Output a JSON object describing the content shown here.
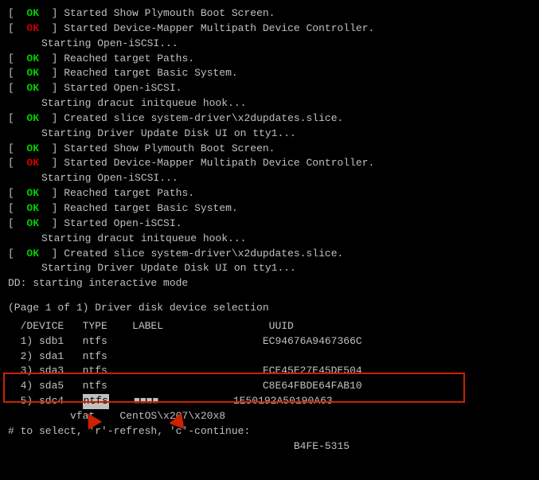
{
  "terminal": {
    "lines": [
      {
        "type": "ok-green",
        "prefix": "[  OK  ]",
        "text": " Started Show Plymouth Boot Screen."
      },
      {
        "type": "ok-red",
        "prefix": "[  OK  ]",
        "text": " Started Device-Mapper Multipath Device Controller."
      },
      {
        "type": "indent",
        "text": "Starting Open-iSCSI..."
      },
      {
        "type": "ok-green",
        "prefix": "[  OK  ]",
        "text": " Reached target Paths."
      },
      {
        "type": "ok-green",
        "prefix": "[  OK  ]",
        "text": " Reached target Basic System."
      },
      {
        "type": "ok-green",
        "prefix": "[  OK  ]",
        "text": " Started Open-iSCSI."
      },
      {
        "type": "indent",
        "text": "Starting dracut initqueue hook..."
      },
      {
        "type": "ok-green",
        "prefix": "[  OK  ]",
        "text": " Created slice system-driver\\x2dupdates.slice."
      },
      {
        "type": "indent",
        "text": "Starting Driver Update Disk UI on tty1..."
      },
      {
        "type": "ok-green",
        "prefix": "[  OK  ]",
        "text": " Started Show Plymouth Boot Screen."
      },
      {
        "type": "ok-red",
        "prefix": "[  OK  ]",
        "text": " Started Device-Mapper Multipath Device Controller."
      },
      {
        "type": "indent",
        "text": "Starting Open-iSCSI..."
      },
      {
        "type": "ok-green",
        "prefix": "[  OK  ]",
        "text": " Reached target Paths."
      },
      {
        "type": "ok-green",
        "prefix": "[  OK  ]",
        "text": " Reached target Basic System."
      },
      {
        "type": "ok-green",
        "prefix": "[  OK  ]",
        "text": " Started Open-iSCSI."
      },
      {
        "type": "indent",
        "text": "Starting dracut initqueue hook..."
      },
      {
        "type": "ok-green",
        "prefix": "[  OK  ]",
        "text": " Created slice system-driver\\x2dupdates.slice."
      },
      {
        "type": "indent",
        "text": "Starting Driver Update Disk UI on tty1..."
      },
      {
        "type": "plain",
        "text": "DD: starting interactive mode"
      },
      {
        "type": "blank"
      },
      {
        "type": "section",
        "text": "(Page 1 of 1) Driver disk device selection"
      },
      {
        "type": "tableheader",
        "cols": [
          "  /DEVICE",
          "TYPE    ",
          "LABEL                ",
          "UUID"
        ]
      },
      {
        "type": "tablerow",
        "num": "1)",
        "device": "sdb1",
        "type_": "ntfs",
        "label": "",
        "uuid": "EC94676A9467366C"
      },
      {
        "type": "tablerow",
        "num": "2)",
        "device": "sda1",
        "type_": "ntfs",
        "label": "",
        "uuid": ""
      },
      {
        "type": "tablerow",
        "num": "3)",
        "device": "sda3",
        "type_": "ntfs",
        "label": "",
        "uuid": "FCE45E27E45DE504"
      },
      {
        "type": "tablerow",
        "num": "4)",
        "device": "sda5",
        "type_": "ntfs",
        "label": "",
        "uuid": "C8E64FBDE64FAB10"
      },
      {
        "type": "tablerow-highlight",
        "num": "5)",
        "device": "sdc4",
        "type_": "vfat",
        "label": "CentOS\\x207\\x20x8",
        "uuid": "1E50192A50190A63"
      },
      {
        "type": "prompt",
        "text": "# to select, 'r'-refresh, 'c'-continue:"
      },
      {
        "type": "footer-uuid",
        "text": "                                              B4FE-5315"
      }
    ]
  }
}
